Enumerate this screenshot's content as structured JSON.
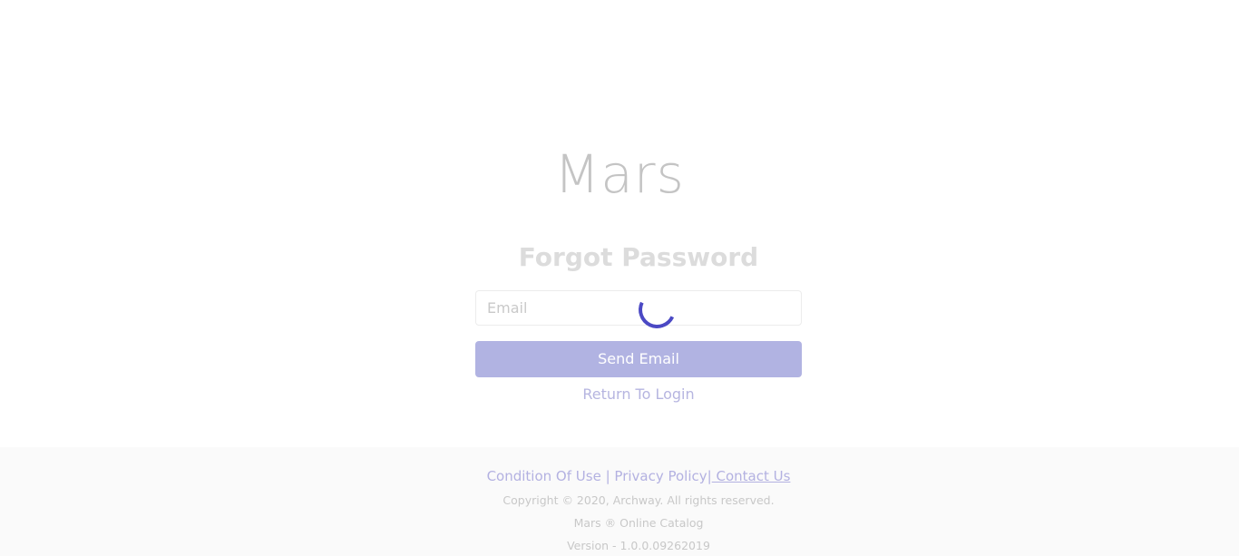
{
  "header": {
    "logo": "Mars"
  },
  "form": {
    "title": "Forgot Password",
    "email_placeholder": "Email",
    "email_value": "",
    "send_button_label": "Send Email",
    "return_link_label": "Return To Login"
  },
  "footer": {
    "links": {
      "condition": "Condition Of Use",
      "sep1": " | ",
      "privacy": "Privacy Policy",
      "sep2": "|",
      "contact": " Contact Us"
    },
    "copyright": "Copyright © 2020, Archway. All rights reserved.",
    "catalog": "Mars ® Online Catalog",
    "version": "Version - 1.0.0.09262019"
  },
  "colors": {
    "accent": "#4b49c4",
    "button": "#b1b3e2",
    "progress": "#4aa6f0"
  },
  "icons": {
    "spinner": "loading-spinner-icon"
  }
}
